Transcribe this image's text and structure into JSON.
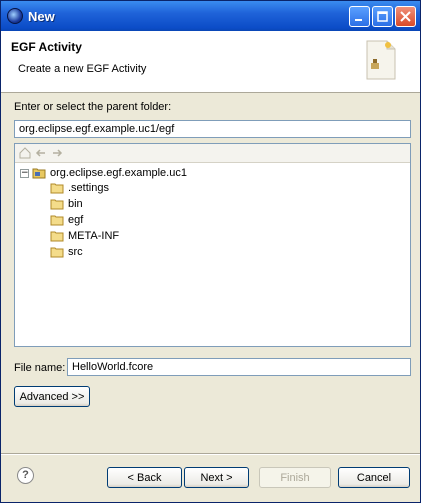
{
  "window": {
    "title": "New"
  },
  "banner": {
    "title": "EGF Activity",
    "description": "Create a new EGF Activity"
  },
  "parent_folder": {
    "label": "Enter or select the parent folder:",
    "value": "org.eclipse.egf.example.uc1/egf"
  },
  "tree": {
    "root": {
      "label": "org.eclipse.egf.example.uc1",
      "expanded": true
    },
    "children": [
      {
        "label": ".settings"
      },
      {
        "label": "bin"
      },
      {
        "label": "egf"
      },
      {
        "label": "META-INF"
      },
      {
        "label": "src"
      }
    ]
  },
  "file_name": {
    "label": "File name:",
    "value": "HelloWorld.fcore"
  },
  "buttons": {
    "advanced": "Advanced >>",
    "back": "< Back",
    "next": "Next >",
    "finish": "Finish",
    "cancel": "Cancel",
    "help": "?"
  },
  "colors": {
    "titlebar": "#0b4cc7",
    "dialog_bg": "#ece9d8",
    "folder": "#e8c860"
  }
}
